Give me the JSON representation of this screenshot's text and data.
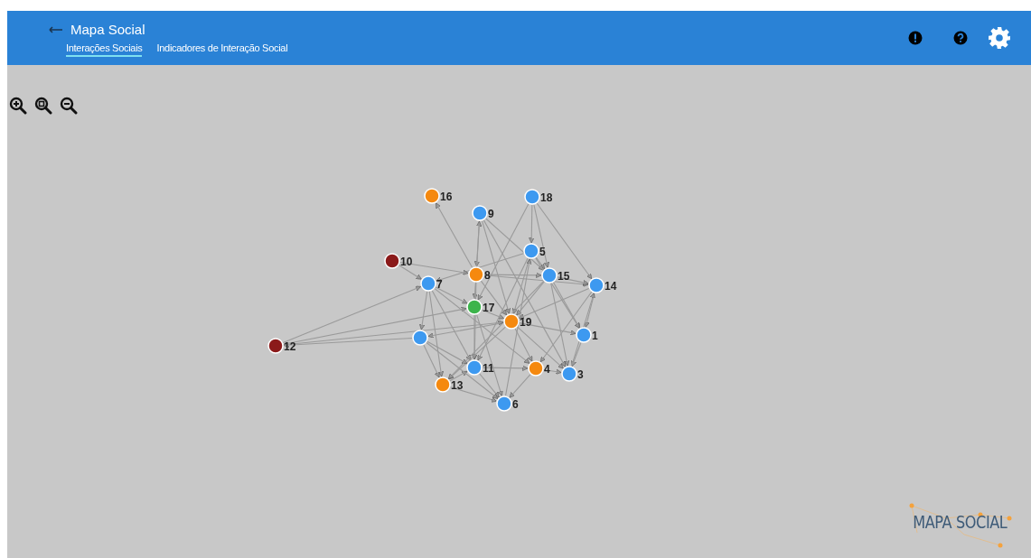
{
  "header": {
    "title": "Mapa Social"
  },
  "tabs": [
    {
      "label": "Interações Sociais",
      "selected": true
    },
    {
      "label": "Indicadores de Interação Social",
      "selected": false
    }
  ],
  "graph": {
    "nodes": [
      {
        "label": "16",
        "color": "#f5890f"
      },
      {
        "label": "9",
        "color": "#3d99f0"
      },
      {
        "label": "18",
        "color": "#3d99f0"
      },
      {
        "label": "5",
        "color": "#3d99f0"
      },
      {
        "label": "10",
        "color": "#8b1a1a"
      },
      {
        "label": "8",
        "color": "#f5890f"
      },
      {
        "label": "15",
        "color": "#3d99f0"
      },
      {
        "label": "14",
        "color": "#3d99f0"
      },
      {
        "label": "7",
        "color": "#3d99f0"
      },
      {
        "label": "17",
        "color": "#3cb44b"
      },
      {
        "label": "19",
        "color": "#f5890f"
      },
      {
        "label": "1",
        "color": "#3d99f0"
      },
      {
        "color": "#3d99f0"
      },
      {
        "label": "12",
        "color": "#8b1a1a"
      },
      {
        "label": "11",
        "color": "#3d99f0"
      },
      {
        "label": "4",
        "color": "#f5890f"
      },
      {
        "label": "3",
        "color": "#3d99f0"
      },
      {
        "label": "13",
        "color": "#f5890f"
      },
      {
        "label": "6",
        "color": "#3d99f0"
      }
    ]
  },
  "logo": {
    "text": "MAPA SOCIAL"
  }
}
